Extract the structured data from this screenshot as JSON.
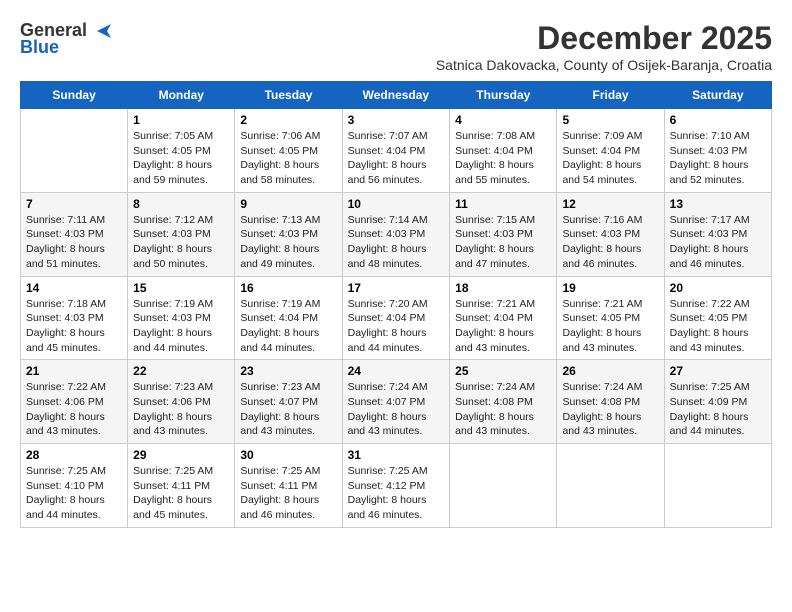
{
  "logo": {
    "general": "General",
    "blue": "Blue"
  },
  "title": {
    "month": "December 2025",
    "subtitle": "Satnica Dakovacka, County of Osijek-Baranja, Croatia"
  },
  "days_of_week": [
    "Sunday",
    "Monday",
    "Tuesday",
    "Wednesday",
    "Thursday",
    "Friday",
    "Saturday"
  ],
  "weeks": [
    {
      "row_bg": "#fff",
      "cells": [
        {
          "day": "",
          "info": ""
        },
        {
          "day": "1",
          "info": "Sunrise: 7:05 AM\nSunset: 4:05 PM\nDaylight: 8 hours\nand 59 minutes."
        },
        {
          "day": "2",
          "info": "Sunrise: 7:06 AM\nSunset: 4:05 PM\nDaylight: 8 hours\nand 58 minutes."
        },
        {
          "day": "3",
          "info": "Sunrise: 7:07 AM\nSunset: 4:04 PM\nDaylight: 8 hours\nand 56 minutes."
        },
        {
          "day": "4",
          "info": "Sunrise: 7:08 AM\nSunset: 4:04 PM\nDaylight: 8 hours\nand 55 minutes."
        },
        {
          "day": "5",
          "info": "Sunrise: 7:09 AM\nSunset: 4:04 PM\nDaylight: 8 hours\nand 54 minutes."
        },
        {
          "day": "6",
          "info": "Sunrise: 7:10 AM\nSunset: 4:03 PM\nDaylight: 8 hours\nand 52 minutes."
        }
      ]
    },
    {
      "row_bg": "#f5f5f5",
      "cells": [
        {
          "day": "7",
          "info": "Sunrise: 7:11 AM\nSunset: 4:03 PM\nDaylight: 8 hours\nand 51 minutes."
        },
        {
          "day": "8",
          "info": "Sunrise: 7:12 AM\nSunset: 4:03 PM\nDaylight: 8 hours\nand 50 minutes."
        },
        {
          "day": "9",
          "info": "Sunrise: 7:13 AM\nSunset: 4:03 PM\nDaylight: 8 hours\nand 49 minutes."
        },
        {
          "day": "10",
          "info": "Sunrise: 7:14 AM\nSunset: 4:03 PM\nDaylight: 8 hours\nand 48 minutes."
        },
        {
          "day": "11",
          "info": "Sunrise: 7:15 AM\nSunset: 4:03 PM\nDaylight: 8 hours\nand 47 minutes."
        },
        {
          "day": "12",
          "info": "Sunrise: 7:16 AM\nSunset: 4:03 PM\nDaylight: 8 hours\nand 46 minutes."
        },
        {
          "day": "13",
          "info": "Sunrise: 7:17 AM\nSunset: 4:03 PM\nDaylight: 8 hours\nand 46 minutes."
        }
      ]
    },
    {
      "row_bg": "#fff",
      "cells": [
        {
          "day": "14",
          "info": "Sunrise: 7:18 AM\nSunset: 4:03 PM\nDaylight: 8 hours\nand 45 minutes."
        },
        {
          "day": "15",
          "info": "Sunrise: 7:19 AM\nSunset: 4:03 PM\nDaylight: 8 hours\nand 44 minutes."
        },
        {
          "day": "16",
          "info": "Sunrise: 7:19 AM\nSunset: 4:04 PM\nDaylight: 8 hours\nand 44 minutes."
        },
        {
          "day": "17",
          "info": "Sunrise: 7:20 AM\nSunset: 4:04 PM\nDaylight: 8 hours\nand 44 minutes."
        },
        {
          "day": "18",
          "info": "Sunrise: 7:21 AM\nSunset: 4:04 PM\nDaylight: 8 hours\nand 43 minutes."
        },
        {
          "day": "19",
          "info": "Sunrise: 7:21 AM\nSunset: 4:05 PM\nDaylight: 8 hours\nand 43 minutes."
        },
        {
          "day": "20",
          "info": "Sunrise: 7:22 AM\nSunset: 4:05 PM\nDaylight: 8 hours\nand 43 minutes."
        }
      ]
    },
    {
      "row_bg": "#f5f5f5",
      "cells": [
        {
          "day": "21",
          "info": "Sunrise: 7:22 AM\nSunset: 4:06 PM\nDaylight: 8 hours\nand 43 minutes."
        },
        {
          "day": "22",
          "info": "Sunrise: 7:23 AM\nSunset: 4:06 PM\nDaylight: 8 hours\nand 43 minutes."
        },
        {
          "day": "23",
          "info": "Sunrise: 7:23 AM\nSunset: 4:07 PM\nDaylight: 8 hours\nand 43 minutes."
        },
        {
          "day": "24",
          "info": "Sunrise: 7:24 AM\nSunset: 4:07 PM\nDaylight: 8 hours\nand 43 minutes."
        },
        {
          "day": "25",
          "info": "Sunrise: 7:24 AM\nSunset: 4:08 PM\nDaylight: 8 hours\nand 43 minutes."
        },
        {
          "day": "26",
          "info": "Sunrise: 7:24 AM\nSunset: 4:08 PM\nDaylight: 8 hours\nand 43 minutes."
        },
        {
          "day": "27",
          "info": "Sunrise: 7:25 AM\nSunset: 4:09 PM\nDaylight: 8 hours\nand 44 minutes."
        }
      ]
    },
    {
      "row_bg": "#fff",
      "cells": [
        {
          "day": "28",
          "info": "Sunrise: 7:25 AM\nSunset: 4:10 PM\nDaylight: 8 hours\nand 44 minutes."
        },
        {
          "day": "29",
          "info": "Sunrise: 7:25 AM\nSunset: 4:11 PM\nDaylight: 8 hours\nand 45 minutes."
        },
        {
          "day": "30",
          "info": "Sunrise: 7:25 AM\nSunset: 4:11 PM\nDaylight: 8 hours\nand 46 minutes."
        },
        {
          "day": "31",
          "info": "Sunrise: 7:25 AM\nSunset: 4:12 PM\nDaylight: 8 hours\nand 46 minutes."
        },
        {
          "day": "",
          "info": ""
        },
        {
          "day": "",
          "info": ""
        },
        {
          "day": "",
          "info": ""
        }
      ]
    }
  ]
}
